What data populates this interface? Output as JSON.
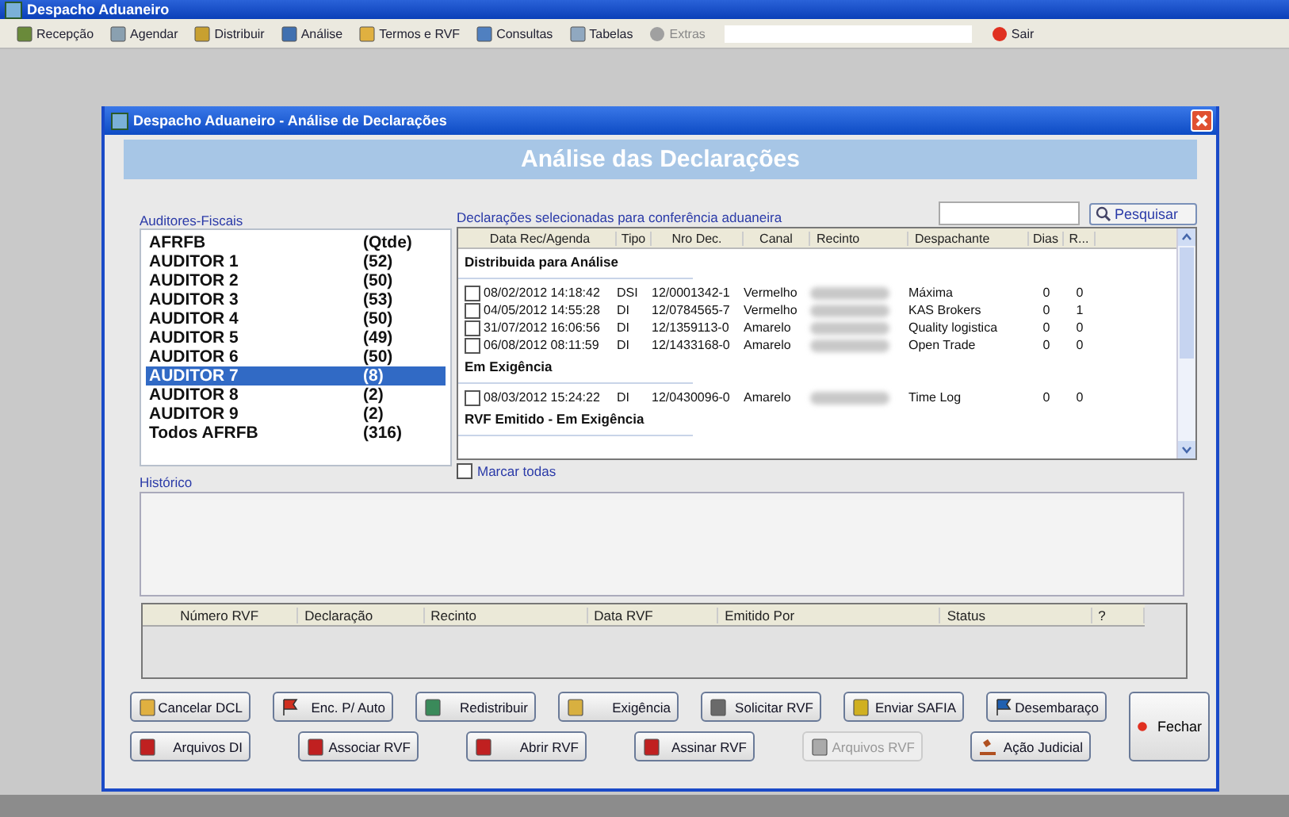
{
  "app": {
    "title": "Despacho Aduaneiro"
  },
  "toolbar": [
    {
      "label": "Recepção",
      "disabled": false
    },
    {
      "label": "Agendar",
      "disabled": false
    },
    {
      "label": "Distribuir",
      "disabled": false
    },
    {
      "label": "Análise",
      "disabled": false
    },
    {
      "label": "Termos e RVF",
      "disabled": false
    },
    {
      "label": "Consultas",
      "disabled": false
    },
    {
      "label": "Tabelas",
      "disabled": false
    },
    {
      "label": "Extras",
      "disabled": true
    },
    {
      "label": "Sair",
      "disabled": false
    }
  ],
  "dialog": {
    "title": "Despacho Aduaneiro - Análise de Declarações",
    "banner": "Análise das Declarações",
    "auditors": {
      "label": "Auditores-Fiscais",
      "header": {
        "name": "AFRFB",
        "count": "(Qtde)"
      },
      "items": [
        {
          "name": "AUDITOR 1",
          "count": "(52)",
          "selected": false
        },
        {
          "name": "AUDITOR 2",
          "count": "(50)",
          "selected": false
        },
        {
          "name": "AUDITOR 3",
          "count": "(53)",
          "selected": false
        },
        {
          "name": "AUDITOR 4",
          "count": "(50)",
          "selected": false
        },
        {
          "name": "AUDITOR 5",
          "count": "(49)",
          "selected": false
        },
        {
          "name": "AUDITOR 6",
          "count": "(50)",
          "selected": false
        },
        {
          "name": "AUDITOR 7",
          "count": "(8)",
          "selected": true
        },
        {
          "name": "AUDITOR 8",
          "count": "(2)",
          "selected": false
        },
        {
          "name": "AUDITOR 9",
          "count": "(2)",
          "selected": false
        },
        {
          "name": "Todos AFRFB",
          "count": "(316)",
          "selected": false
        }
      ]
    },
    "declarations": {
      "label": "Declarações selecionadas para conferência aduaneira",
      "search_button": "Pesquisar",
      "columns": [
        "Data Rec/Agenda",
        "Tipo",
        "Nro Dec.",
        "Canal",
        "Recinto",
        "Despachante",
        "Dias",
        "R..."
      ],
      "groups": [
        {
          "title": "Distribuida para Análise",
          "rows": [
            {
              "checked": false,
              "date": "08/02/2012 14:18:42",
              "tipo": "DSI",
              "nro": "12/0001342-1",
              "canal": "Vermelho",
              "despachante": "Máxima",
              "dias": "0",
              "r": "0"
            },
            {
              "checked": false,
              "date": "04/05/2012 14:55:28",
              "tipo": "DI",
              "nro": "12/0784565-7",
              "canal": "Vermelho",
              "despachante": "KAS Brokers",
              "dias": "0",
              "r": "1"
            },
            {
              "checked": false,
              "date": "31/07/2012 16:06:56",
              "tipo": "DI",
              "nro": "12/1359113-0",
              "canal": "Amarelo",
              "despachante": "Quality logistica",
              "dias": "0",
              "r": "0"
            },
            {
              "checked": false,
              "date": "06/08/2012 08:11:59",
              "tipo": "DI",
              "nro": "12/1433168-0",
              "canal": "Amarelo",
              "despachante": "Open Trade",
              "dias": "0",
              "r": "0"
            }
          ]
        },
        {
          "title": "Em Exigência",
          "rows": [
            {
              "checked": false,
              "date": "08/03/2012 15:24:22",
              "tipo": "DI",
              "nro": "12/0430096-0",
              "canal": "Amarelo",
              "despachante": "Time Log",
              "dias": "0",
              "r": "0"
            }
          ]
        },
        {
          "title": "RVF Emitido - Em Exigência"
        }
      ],
      "mark_all": {
        "label": "Marcar todas",
        "checked": false
      }
    },
    "history": {
      "label": "Histórico"
    },
    "rvf_table": {
      "columns": [
        "Número RVF",
        "Declaração",
        "Recinto",
        "Data RVF",
        "Emitido Por",
        "Status",
        "?"
      ]
    },
    "buttons": [
      [
        {
          "label": "Cancelar DCL",
          "disabled": false
        },
        {
          "label": "Enc. P/ Auto",
          "disabled": false
        },
        {
          "label": "Redistribuir",
          "disabled": false
        },
        {
          "label": "Exigência",
          "disabled": false
        },
        {
          "label": "Solicitar RVF",
          "disabled": false
        },
        {
          "label": "Enviar SAFIA",
          "disabled": false
        },
        {
          "label": "Desembaraço",
          "disabled": false
        }
      ],
      [
        {
          "label": "Arquivos DI",
          "disabled": false
        },
        {
          "label": "Associar RVF",
          "disabled": false
        },
        {
          "label": "Abrir RVF",
          "disabled": false
        },
        {
          "label": "Assinar RVF",
          "disabled": false
        },
        {
          "label": "Arquivos RVF",
          "disabled": true
        },
        {
          "label": "Ação Judicial",
          "disabled": false
        }
      ]
    ],
    "close_button": {
      "label": "Fechar"
    }
  }
}
